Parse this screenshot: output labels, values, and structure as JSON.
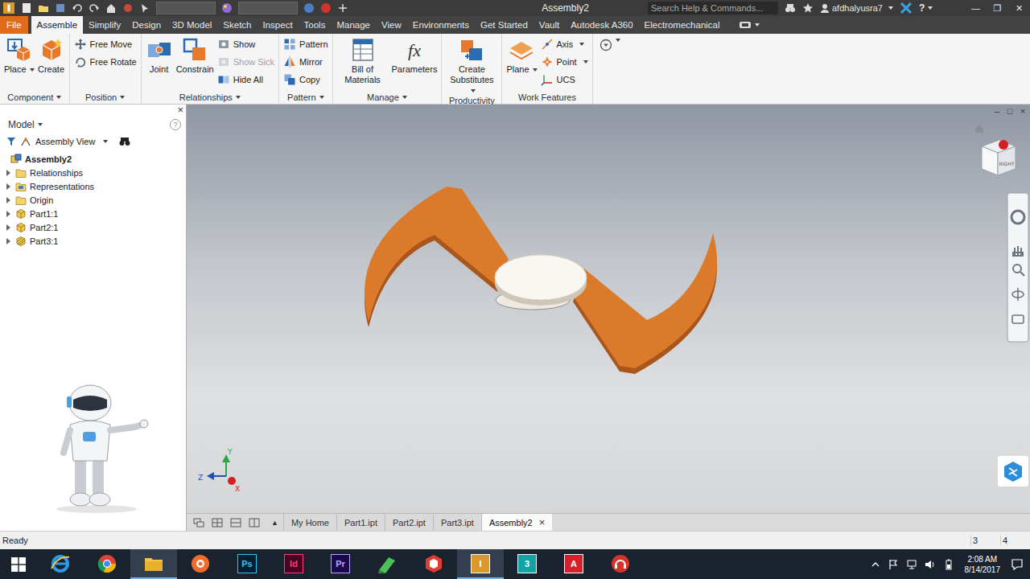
{
  "window": {
    "title": "Assembly2",
    "search_placeholder": "Search Help & Commands...",
    "user": "afdhalyusra7",
    "help": "?",
    "controls": [
      "—",
      "❐",
      "✕"
    ]
  },
  "ribbon_tabs": [
    {
      "label": "File",
      "kind": "file",
      "selected": false
    },
    {
      "label": "Assemble",
      "kind": "tab",
      "selected": true
    },
    {
      "label": "Simplify",
      "kind": "tab",
      "selected": false
    },
    {
      "label": "Design",
      "kind": "tab",
      "selected": false
    },
    {
      "label": "3D Model",
      "kind": "tab",
      "selected": false
    },
    {
      "label": "Sketch",
      "kind": "tab",
      "selected": false
    },
    {
      "label": "Inspect",
      "kind": "tab",
      "selected": false
    },
    {
      "label": "Tools",
      "kind": "tab",
      "selected": false
    },
    {
      "label": "Manage",
      "kind": "tab",
      "selected": false
    },
    {
      "label": "View",
      "kind": "tab",
      "selected": false
    },
    {
      "label": "Environments",
      "kind": "tab",
      "selected": false
    },
    {
      "label": "Get Started",
      "kind": "tab",
      "selected": false
    },
    {
      "label": "Vault",
      "kind": "tab",
      "selected": false
    },
    {
      "label": "Autodesk A360",
      "kind": "tab",
      "selected": false
    },
    {
      "label": "Electromechanical",
      "kind": "tab",
      "selected": false
    }
  ],
  "ribbon_groups": [
    {
      "title": "Component",
      "dropdown": true,
      "tools": [
        {
          "label": "Place",
          "kind": "large",
          "dropdown": true,
          "disabled": false
        },
        {
          "label": "Create",
          "kind": "large",
          "dropdown": false,
          "disabled": false
        }
      ]
    },
    {
      "title": "Position",
      "dropdown": true,
      "tools": [
        {
          "label": "Free Move",
          "kind": "small",
          "dropdown": false,
          "disabled": false
        },
        {
          "label": "Free Rotate",
          "kind": "small",
          "dropdown": false,
          "disabled": false
        }
      ]
    },
    {
      "title": "Relationships",
      "dropdown": true,
      "tools": [
        {
          "label": "Joint",
          "kind": "large",
          "dropdown": false,
          "disabled": false
        },
        {
          "label": "Constrain",
          "kind": "large",
          "dropdown": false,
          "disabled": false
        },
        {
          "label": "Show",
          "kind": "small",
          "dropdown": false,
          "disabled": false
        },
        {
          "label": "Show Sick",
          "kind": "small",
          "dropdown": false,
          "disabled": true
        },
        {
          "label": "Hide All",
          "kind": "small",
          "dropdown": false,
          "disabled": false
        }
      ]
    },
    {
      "title": "Pattern",
      "dropdown": true,
      "tools": [
        {
          "label": "Pattern",
          "kind": "small",
          "dropdown": false,
          "disabled": false
        },
        {
          "label": "Mirror",
          "kind": "small",
          "dropdown": false,
          "disabled": false
        },
        {
          "label": "Copy",
          "kind": "small",
          "dropdown": false,
          "disabled": false
        }
      ]
    },
    {
      "title": "Manage",
      "dropdown": true,
      "tools": [
        {
          "label": "Bill of Materials",
          "kind": "large",
          "dropdown": false,
          "disabled": false
        },
        {
          "label": "Parameters",
          "kind": "large",
          "dropdown": false,
          "disabled": false,
          "glyph": "fx"
        }
      ]
    },
    {
      "title": "Productivity",
      "dropdown": false,
      "tools": [
        {
          "label": "Create Substitutes",
          "kind": "large",
          "dropdown": true,
          "disabled": false
        }
      ]
    },
    {
      "title": "Work Features",
      "dropdown": false,
      "tools": [
        {
          "label": "Plane",
          "kind": "large",
          "dropdown": true,
          "disabled": false
        },
        {
          "label": "Axis",
          "kind": "small",
          "dropdown": true,
          "disabled": false
        },
        {
          "label": "Point",
          "kind": "small",
          "dropdown": true,
          "disabled": false
        },
        {
          "label": "UCS",
          "kind": "small",
          "dropdown": false,
          "disabled": false
        }
      ]
    }
  ],
  "browser": {
    "title": "Model",
    "help": "?",
    "close": "×",
    "view": "Assembly View",
    "tree": [
      {
        "label": "Assembly2",
        "kind": "assembly",
        "root": true
      },
      {
        "label": "Relationships",
        "kind": "folder",
        "root": false,
        "expanded": false
      },
      {
        "label": "Representations",
        "kind": "representations",
        "root": false,
        "expanded": false
      },
      {
        "label": "Origin",
        "kind": "folder",
        "root": false,
        "expanded": false
      },
      {
        "label": "Part1:1",
        "kind": "part",
        "root": false,
        "expanded": false
      },
      {
        "label": "Part2:1",
        "kind": "part",
        "root": false,
        "expanded": false
      },
      {
        "label": "Part3:1",
        "kind": "part-adaptive",
        "root": false,
        "expanded": false
      }
    ]
  },
  "viewport": {
    "controls": [
      "–",
      "□",
      "×"
    ],
    "viewcube_label": "RIGHT",
    "triad": [
      {
        "label": "Y",
        "color": "#27a844"
      },
      {
        "label": "Z",
        "color": "#1f4fbf"
      },
      {
        "label": "X",
        "color": "#d42020"
      }
    ]
  },
  "document_tabs": {
    "overflow": "▲",
    "close": "×",
    "tabs": [
      {
        "label": "My Home",
        "selected": false
      },
      {
        "label": "Part1.ipt",
        "selected": false
      },
      {
        "label": "Part2.ipt",
        "selected": false
      },
      {
        "label": "Part3.ipt",
        "selected": false
      },
      {
        "label": "Assembly2",
        "selected": true
      }
    ]
  },
  "status_bar": {
    "text": "Ready",
    "counts": [
      "3",
      "4"
    ]
  },
  "taskbar": {
    "time": "2:08 AM",
    "date": "8/14/2017",
    "apps": [
      {
        "kind": "logo",
        "open": false
      },
      {
        "kind": "logo",
        "open": false
      },
      {
        "kind": "logo",
        "open": true
      },
      {
        "kind": "logo",
        "open": false
      },
      {
        "kind": "letter",
        "glyph": "Ps",
        "color": "#31c5f0",
        "background": "#061e33",
        "open": false
      },
      {
        "kind": "letter",
        "glyph": "Id",
        "color": "#ff3d85",
        "background": "#49021f",
        "open": false
      },
      {
        "kind": "letter",
        "glyph": "Pr",
        "color": "#b7a6ff",
        "background": "#1a0a4d",
        "open": false
      },
      {
        "kind": "logo",
        "open": false
      },
      {
        "kind": "logo",
        "open": false
      },
      {
        "kind": "letter",
        "glyph": "I",
        "color": "#ffffff",
        "background": "#d99a2b",
        "open": true
      },
      {
        "kind": "letter",
        "glyph": "3",
        "color": "#ffffff",
        "background": "#12a4a4",
        "open": false
      },
      {
        "kind": "letter",
        "glyph": "A",
        "color": "#ffffff",
        "background": "#d8202c",
        "open": false
      },
      {
        "kind": "logo",
        "open": false
      }
    ]
  }
}
